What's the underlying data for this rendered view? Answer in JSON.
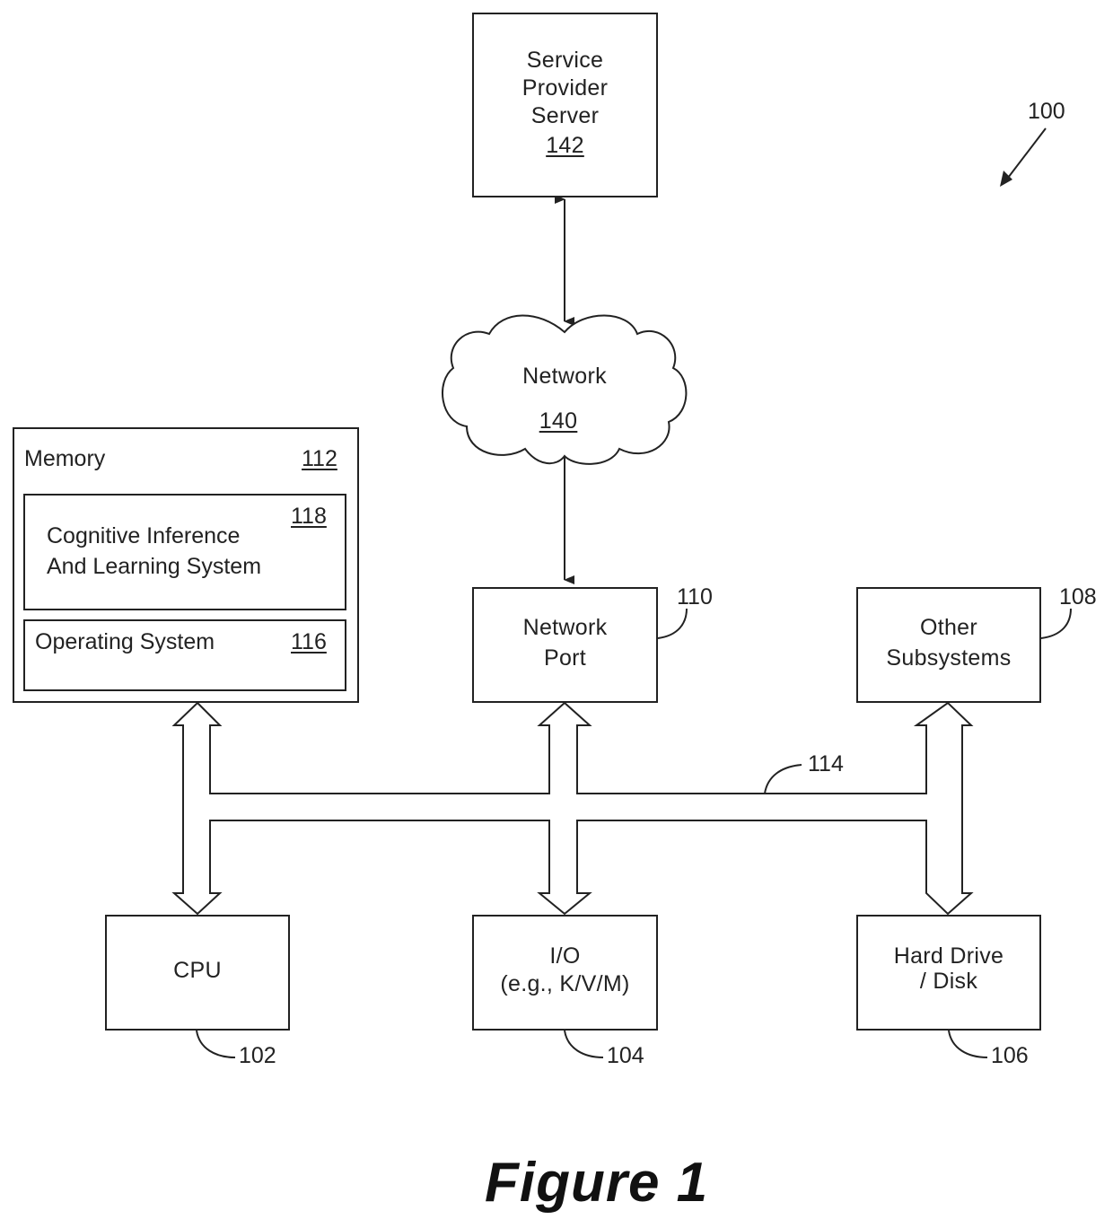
{
  "figure": {
    "title": "Figure 1",
    "system_ref": "100"
  },
  "nodes": {
    "server": {
      "lines": [
        "Service",
        "Provider",
        "Server"
      ],
      "ref": "142"
    },
    "network": {
      "label": "Network",
      "ref": "140"
    },
    "memory": {
      "label": "Memory",
      "ref": "112"
    },
    "cils": {
      "lines": [
        "Cognitive Inference",
        "And Learning System"
      ],
      "ref": "118"
    },
    "os": {
      "label": "Operating System",
      "ref": "116"
    },
    "network_port": {
      "lines": [
        "Network",
        "Port"
      ],
      "ref": "110"
    },
    "other_subsystems": {
      "lines": [
        "Other",
        "Subsystems"
      ],
      "ref": "108"
    },
    "cpu": {
      "label": "CPU",
      "ref": "102"
    },
    "io": {
      "lines": [
        "I/O",
        "(e.g., K/V/M)"
      ],
      "ref": "104"
    },
    "hard_drive": {
      "lines": [
        "Hard Drive",
        "/ Disk"
      ],
      "ref": "106"
    }
  },
  "bus": {
    "ref": "114"
  },
  "connections": [
    {
      "from": "server",
      "to": "network",
      "type": "bidirectional-line"
    },
    {
      "from": "network",
      "to": "network_port",
      "type": "bidirectional-line"
    },
    {
      "from": "memory",
      "to": "bus",
      "type": "bidirectional-bus-arrow"
    },
    {
      "from": "network_port",
      "to": "bus",
      "type": "bidirectional-bus-arrow"
    },
    {
      "from": "other_subsystems",
      "to": "bus",
      "type": "bidirectional-bus-arrow"
    },
    {
      "from": "bus",
      "to": "cpu",
      "type": "bidirectional-bus-arrow"
    },
    {
      "from": "bus",
      "to": "io",
      "type": "bidirectional-bus-arrow"
    },
    {
      "from": "bus",
      "to": "hard_drive",
      "type": "bidirectional-bus-arrow"
    }
  ]
}
